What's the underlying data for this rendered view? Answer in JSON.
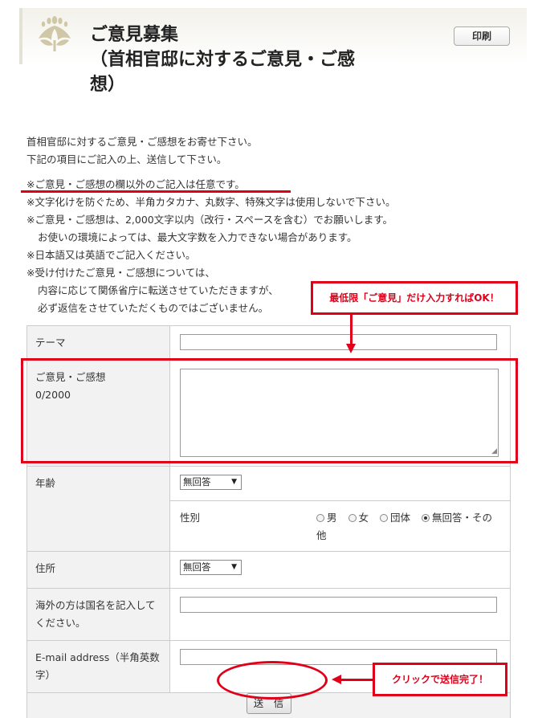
{
  "header": {
    "title_line1": "ご意見募集",
    "title_line2": "（首相官邸に対するご意見・ご感",
    "title_line3": "想）",
    "print_label": "印刷"
  },
  "intro": {
    "line1": "首相官邸に対するご意見・ご感想をお寄せ下さい。",
    "line2": "下記の項目にご記入の上、送信して下さい。",
    "note1": "※ご意見・ご感想の欄以外のご記入は任意です。",
    "note2": "※文字化けを防ぐため、半角カタカナ、丸数字、特殊文字は使用しないで下さい。",
    "note3": "※ご意見・ご感想は、2,000文字以内（改行・スペースを含む）でお願いします。",
    "note3b": "お使いの環境によっては、最大文字数を入力できない場合があります。",
    "note4": "※日本語又は英語でご記入ください。",
    "note5": "※受け付けたご意見・ご感想については、",
    "note5b": "内容に応じて関係省庁に転送させていただきますが、",
    "note5c": "必ず返信をさせていただくものではございません。"
  },
  "form": {
    "theme_label": "テーマ",
    "opinion_label": "ご意見・ご感想",
    "opinion_counter": "0/2000",
    "age_label": "年齢",
    "age_value": "無回答",
    "gender_label": "性別",
    "gender_options": [
      "男",
      "女",
      "団体",
      "無回答・その他"
    ],
    "gender_selected": "無回答・その他",
    "address_label": "住所",
    "address_value": "無回答",
    "overseas_label": "海外の方は国名を記入してください。",
    "email_label": "E-mail address（半角英数字）",
    "submit_label": "送　信"
  },
  "annotations": {
    "top_callout": "最低限「ご意見」だけ入力すればOK！",
    "bottom_callout": "クリックで送信完了！",
    "accent_color": "#e0001a"
  }
}
